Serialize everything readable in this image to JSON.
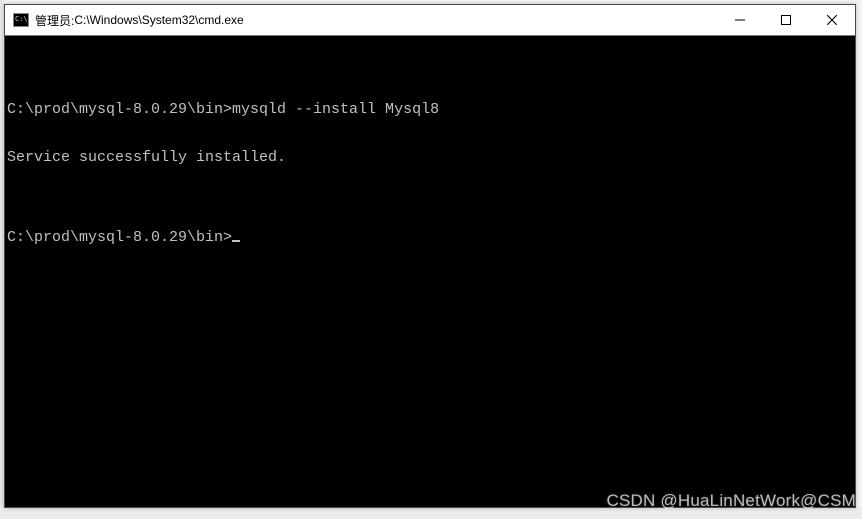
{
  "window": {
    "title_prefix": "管理员: ",
    "title_path": "C:\\Windows\\System32\\cmd.exe",
    "icon": "cmd-icon",
    "controls": {
      "minimize": "minimize",
      "maximize": "maximize",
      "close": "close"
    }
  },
  "terminal": {
    "lines": [
      "",
      "C:\\prod\\mysql-8.0.29\\bin>mysqld --install Mysql8",
      "Service successfully installed.",
      "",
      "C:\\prod\\mysql-8.0.29\\bin>"
    ],
    "prompt_cwd": "C:\\prod\\mysql-8.0.29\\bin",
    "last_command": "mysqld --install Mysql8",
    "last_output": "Service successfully installed.",
    "cursor_visible": true
  },
  "watermark": "CSDN @HuaLinNetWork@CSM"
}
